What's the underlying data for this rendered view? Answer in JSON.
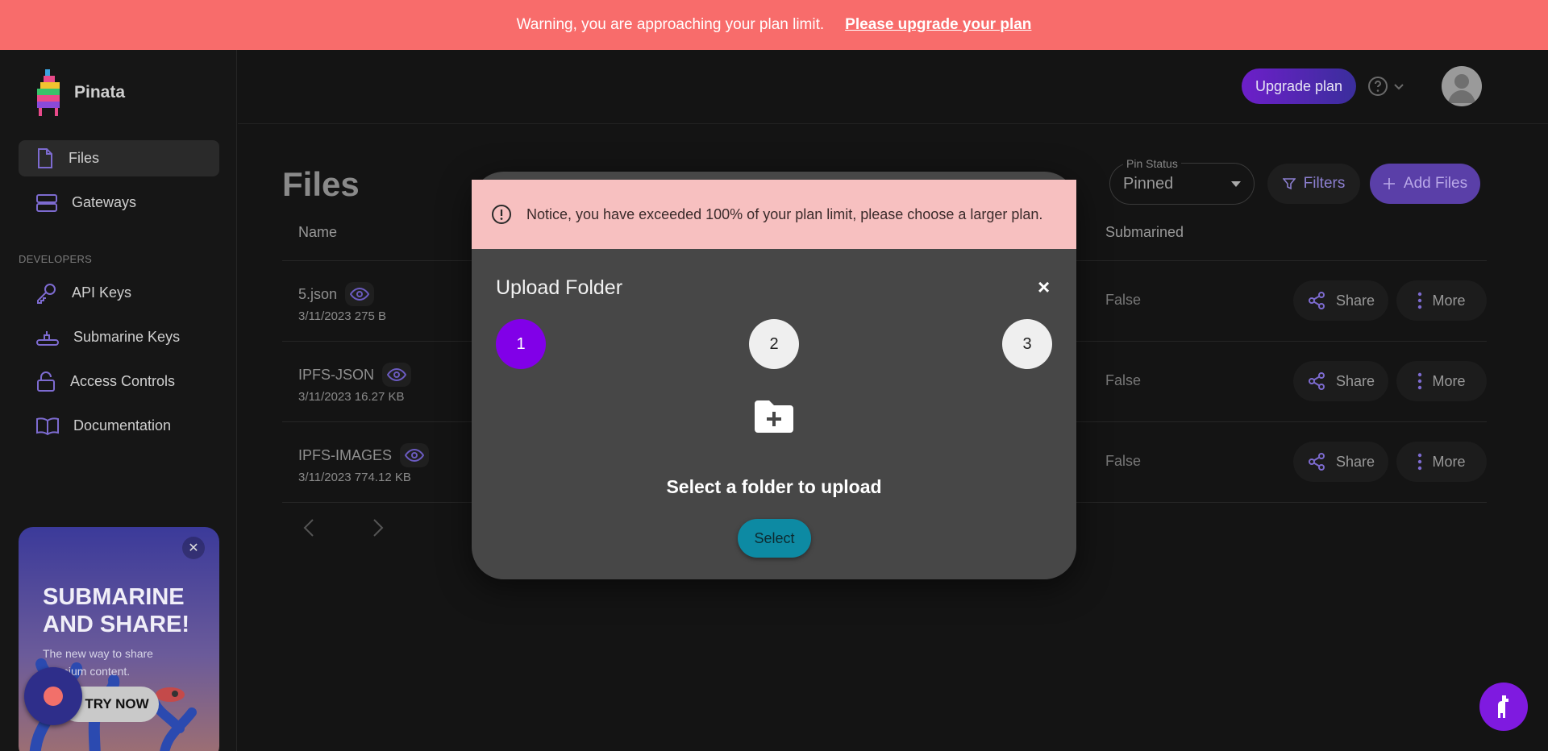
{
  "banner": {
    "warning_text": "Warning, you are approaching your plan limit.",
    "upgrade_link": "Please upgrade your plan",
    "bg_color": "#f86c6b"
  },
  "sidebar": {
    "brand": "Pinata",
    "items": [
      {
        "label": "Files",
        "icon": "file-icon",
        "active": true
      },
      {
        "label": "Gateways",
        "icon": "server-icon",
        "active": false
      }
    ],
    "developers_label": "DEVELOPERS",
    "dev_items": [
      {
        "label": "API Keys",
        "icon": "key-icon"
      },
      {
        "label": "Submarine Keys",
        "icon": "submarine-icon"
      },
      {
        "label": "Access Controls",
        "icon": "lock-icon"
      },
      {
        "label": "Documentation",
        "icon": "book-icon"
      }
    ],
    "promo": {
      "title": "SUBMARINE AND SHARE!",
      "subtitle": "The new way to share premium content.",
      "button": "TRY NOW",
      "close": "✕"
    }
  },
  "header": {
    "upgrade_button": "Upgrade plan",
    "help_icon": "question-circle-icon"
  },
  "files_page": {
    "title": "Files",
    "pin_status_label": "Pin Status",
    "pin_status_value": "Pinned",
    "filters_button": "Filters",
    "add_files_button": "Add Files",
    "columns": {
      "name": "Name",
      "submarined": "Submarined"
    },
    "rows": [
      {
        "name": "5.json",
        "meta": "3/11/2023 275 B",
        "submarined": "False",
        "share": "Share",
        "more": "More"
      },
      {
        "name": "IPFS-JSON",
        "meta": "3/11/2023 16.27 KB",
        "submarined": "False",
        "share": "Share",
        "more": "More"
      },
      {
        "name": "IPFS-IMAGES",
        "meta": "3/11/2023 774.12 KB",
        "submarined": "False",
        "share": "Share",
        "more": "More"
      }
    ]
  },
  "modal": {
    "notice": "Notice, you have exceeded 100% of your plan limit, please choose a larger plan.",
    "title": "Upload Folder",
    "close": "×",
    "steps": [
      "1",
      "2",
      "3"
    ],
    "active_step": 1,
    "prompt": "Select a folder to upload",
    "select_button": "Select"
  },
  "colors": {
    "accent": "#8100e8",
    "select_button": "#0d8aa3",
    "notice_bg": "#f7c0c0",
    "modal_bg": "#474747"
  }
}
